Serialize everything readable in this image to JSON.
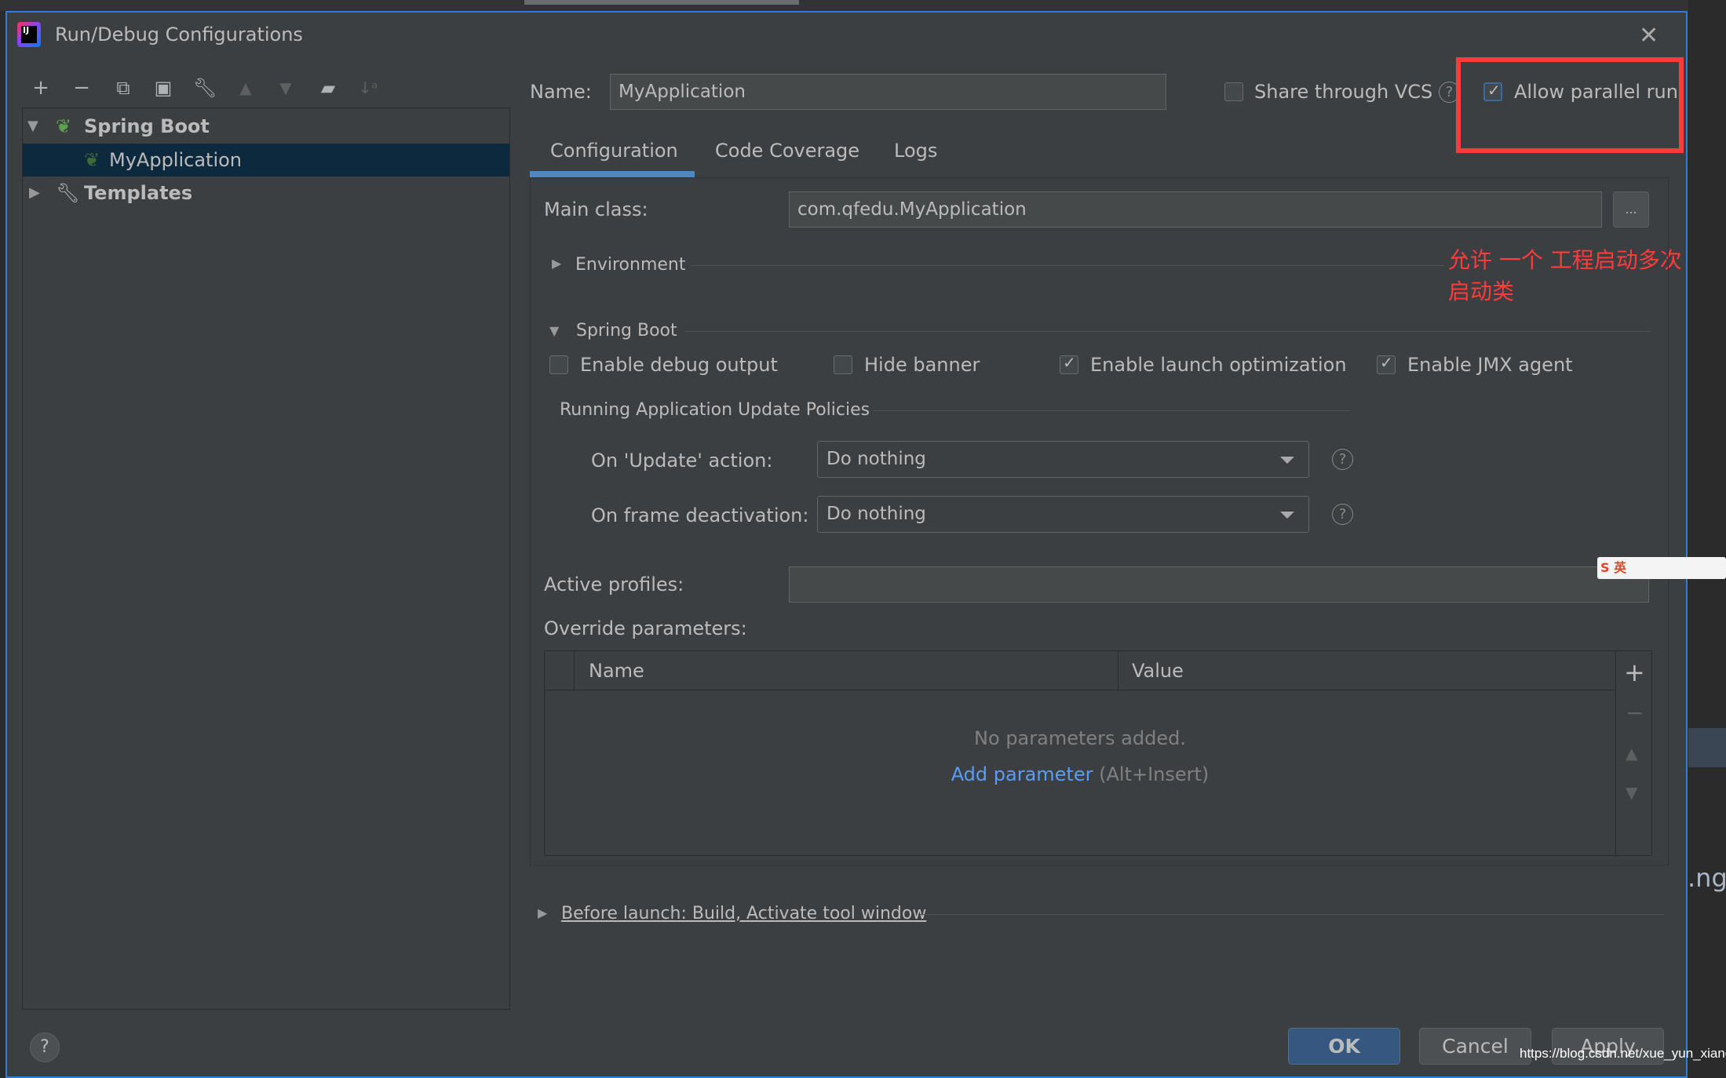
{
  "window": {
    "title": "Run/Debug Configurations",
    "logo": "IJ"
  },
  "background": {
    "partial_text": ".ng"
  },
  "toolbar": {
    "icons": [
      "plus-icon",
      "minus-icon",
      "copy-icon",
      "save-icon",
      "wrench-icon",
      "arrow-up-icon",
      "arrow-down-icon",
      "new-folder-icon",
      "sort-alpha-icon"
    ]
  },
  "tree": {
    "spring_boot": "Spring Boot",
    "my_application": "MyApplication",
    "templates": "Templates"
  },
  "name_field": {
    "label": "Name:",
    "value": "MyApplication"
  },
  "share_vcs": {
    "label": "Share through VCS",
    "checked": false
  },
  "allow_parallel": {
    "label": "Allow parallel run",
    "checked": true
  },
  "annotation": {
    "line1": "允许 一个 工程启动多次",
    "line2": "启动类",
    "color": "#ff3b3b"
  },
  "tabs": [
    {
      "label": "Configuration",
      "active": true
    },
    {
      "label": "Code Coverage"
    },
    {
      "label": "Logs"
    }
  ],
  "config": {
    "main_class_label": "Main class:",
    "main_class_value": "com.qfedu.MyApplication",
    "browse_label": "...",
    "environment": "Environment",
    "spring_boot_section": "Spring Boot",
    "checkboxes": [
      {
        "label": "Enable debug output",
        "checked": false
      },
      {
        "label": "Hide banner",
        "checked": false
      },
      {
        "label": "Enable launch optimization",
        "checked": true
      },
      {
        "label": "Enable JMX agent",
        "checked": true
      }
    ],
    "policies_title": "Running Application Update Policies",
    "update_action_label": "On 'Update' action:",
    "update_action_value": "Do nothing",
    "frame_deactivation_label": "On frame deactivation:",
    "frame_deactivation_value": "Do nothing",
    "active_profiles_label": "Active profiles:",
    "active_profiles_value": "",
    "override_label": "Override parameters:",
    "table": {
      "columns": [
        "Name",
        "Value"
      ],
      "empty": "No parameters added.",
      "add_link": "Add parameter",
      "add_shortcut": "(Alt+Insert)"
    }
  },
  "before_launch": "Before launch: Build, Activate tool window",
  "buttons": {
    "ok": "OK",
    "cancel": "Cancel",
    "apply": "Apply",
    "help": "?"
  },
  "watermark": "https://blog.csdn.net/xue_yun_xiang",
  "ime": {
    "label": "S 英"
  }
}
